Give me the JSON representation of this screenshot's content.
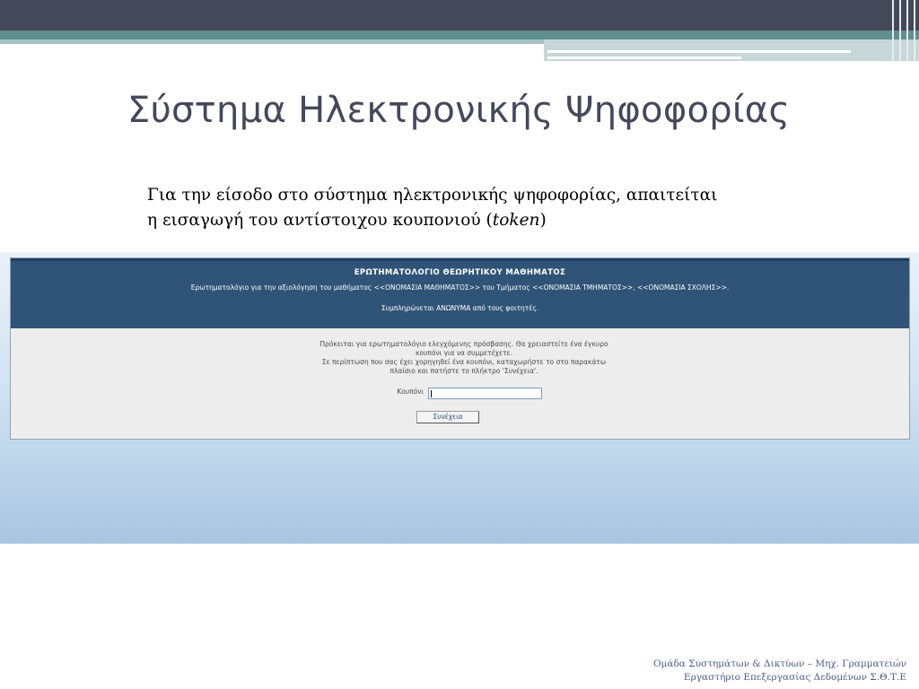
{
  "slide": {
    "title": "Σύστημα Ηλεκτρονικής Ψηφοφορίας",
    "intro_line1": "Για την είσοδο στο σύστημα ηλεκτρονικής ψηφοφορίας, απαιτείται",
    "intro_line2_prefix": "η εισαγωγή του αντίστοιχου κουπονιού (",
    "intro_line2_token": "token",
    "intro_line2_suffix": ")"
  },
  "form": {
    "title": "ΕΡΩΤΗΜΑΤΟΛΟΓΙΟ ΘΕΩΡΗΤΙΚΟΥ ΜΑΘΗΜΑΤΟΣ",
    "subtitle": "Ερωτηματολόγιο για την αξιολόγηση του μαθήματος <<ΟΝΟΜΑΣΙΑ ΜΑΘΗΜΑΤΟΣ>> του Τμήματος <<ΟΝΟΜΑΣΙΑ ΤΜΗΜΑΤΟΣ>>, <<ΟΝΟΜΑΣΙΑ ΣΧΟΛΗΣ>>.",
    "anonymous_note": "Συμπληρώνεται ΑΝΩΝΥΜΑ από τους φοιτητές.",
    "body_line1": "Πρόκειται για ερωτηματολόγιο ελεγχόμενης πρόσβασης. Θα χρειαστείτε ένα έγκυρο",
    "body_line2": "κουπόνι για να συμμετέχετε.",
    "body_line3": "Σε περίπτωση που σας έχει χορηγηθεί ένα κουπόνι, καταχωρήστε το στο παρακάτω",
    "body_line4": "πλαίσιο και πατήστε το πλήκτρο 'Συνέχεια'.",
    "coupon_label": "Κουπόνι",
    "coupon_value": "",
    "continue_label": "Συνέχεια"
  },
  "footer": {
    "line1": "Ομάδα Συστημάτων & Δικτύων – Μηχ. Γραμματειών",
    "line2": "Εργαστήριο Επεξεργασίας Δεδομένων Σ.Θ.Τ.Ε"
  },
  "colors": {
    "top_bar": "#43485a",
    "teal_band": "#5f8f8f",
    "form_header": "#2f5477",
    "title_text": "#43485a",
    "footer_text": "#4a5d84"
  }
}
